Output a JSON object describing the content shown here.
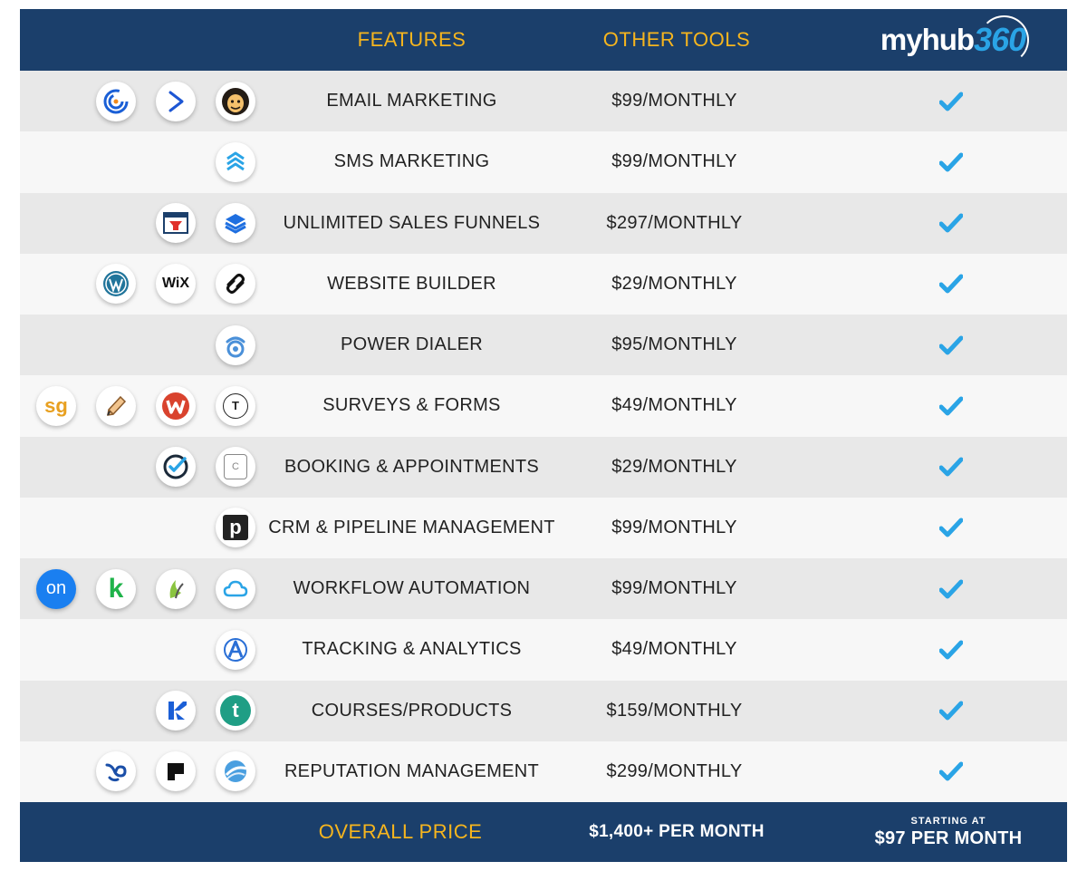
{
  "header": {
    "features_label": "FEATURES",
    "other_tools_label": "OTHER TOOLS",
    "brand": {
      "prefix": "myhub",
      "number": "360"
    }
  },
  "rows": [
    {
      "feature": "EMAIL MARKETING",
      "price": "$99/MONTHLY",
      "icons": [
        "constant-contact-icon",
        "activecampaign-icon",
        "mailchimp-icon"
      ]
    },
    {
      "feature": "SMS MARKETING",
      "price": "$99/MONTHLY",
      "icons": [
        "layers-chevron-icon"
      ]
    },
    {
      "feature": "UNLIMITED SALES FUNNELS",
      "price": "$297/MONTHLY",
      "icons": [
        "clickfunnels-icon",
        "stack-layers-icon"
      ]
    },
    {
      "feature": "WEBSITE BUILDER",
      "price": "$29/MONTHLY",
      "icons": [
        "wordpress-icon",
        "wix-icon",
        "squarespace-icon"
      ]
    },
    {
      "feature": "POWER DIALER",
      "price": "$95/MONTHLY",
      "icons": [
        "dialer-icon"
      ]
    },
    {
      "feature": "SURVEYS & FORMS",
      "price": "$49/MONTHLY",
      "icons": [
        "surveygizmo-icon",
        "pencil-icon",
        "wufoo-icon",
        "typeform-icon"
      ]
    },
    {
      "feature": "BOOKING & APPOINTMENTS",
      "price": "$29/MONTHLY",
      "icons": [
        "check-circle-icon",
        "calendar-icon"
      ]
    },
    {
      "feature": "CRM & PIPELINE MANAGEMENT",
      "price": "$99/MONTHLY",
      "icons": [
        "pipedrive-icon"
      ]
    },
    {
      "feature": "WORKFLOW AUTOMATION",
      "price": "$99/MONTHLY",
      "icons": [
        "ontraport-icon",
        "keap-icon",
        "infusionsoft-icon",
        "cloud-icon"
      ]
    },
    {
      "feature": "TRACKING & ANALYTICS",
      "price": "$49/MONTHLY",
      "icons": [
        "analytics-a-icon"
      ]
    },
    {
      "feature": "COURSES/PRODUCTS",
      "price": "$159/MONTHLY",
      "icons": [
        "kajabi-icon",
        "teachable-icon"
      ]
    },
    {
      "feature": "REPUTATION MANAGEMENT",
      "price": "$299/MONTHLY",
      "icons": [
        "birdeye-icon",
        "podium-icon",
        "swirl-icon"
      ]
    }
  ],
  "icon_text": {
    "wix": "WiX",
    "sg": "sg",
    "typeform": "T",
    "calendar": "C",
    "pipedrive": "p",
    "ontraport": "on",
    "keap": "k",
    "teachable": "t"
  },
  "footer": {
    "label": "OVERALL PRICE",
    "other_total": "$1,400+ PER MONTH",
    "starting_at": "STARTING AT",
    "brand_price": "$97 PER MONTH"
  },
  "colors": {
    "navy": "#1b3f6b",
    "gold": "#f6b51e",
    "check_blue": "#2aa4e6",
    "row_odd": "#e8e8e8",
    "row_even": "#f7f7f7"
  }
}
